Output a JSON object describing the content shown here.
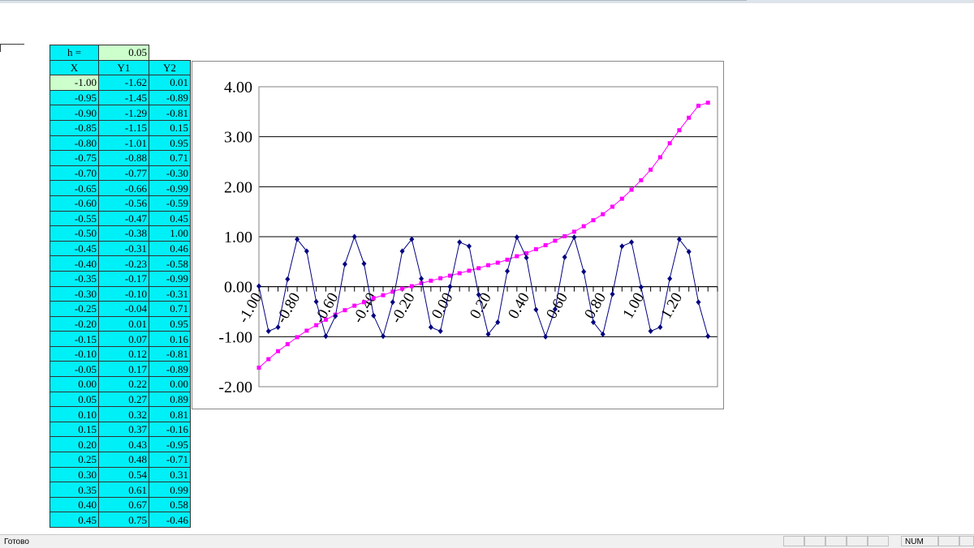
{
  "sheet": {
    "step_label": "h =",
    "step_value": "0.05",
    "headers": [
      "X",
      "Y1",
      "Y2"
    ],
    "rows": [
      [
        "-1.00",
        "-1.62",
        "0.01"
      ],
      [
        "-0.95",
        "-1.45",
        "-0.89"
      ],
      [
        "-0.90",
        "-1.29",
        "-0.81"
      ],
      [
        "-0.85",
        "-1.15",
        "0.15"
      ],
      [
        "-0.80",
        "-1.01",
        "0.95"
      ],
      [
        "-0.75",
        "-0.88",
        "0.71"
      ],
      [
        "-0.70",
        "-0.77",
        "-0.30"
      ],
      [
        "-0.65",
        "-0.66",
        "-0.99"
      ],
      [
        "-0.60",
        "-0.56",
        "-0.59"
      ],
      [
        "-0.55",
        "-0.47",
        "0.45"
      ],
      [
        "-0.50",
        "-0.38",
        "1.00"
      ],
      [
        "-0.45",
        "-0.31",
        "0.46"
      ],
      [
        "-0.40",
        "-0.23",
        "-0.58"
      ],
      [
        "-0.35",
        "-0.17",
        "-0.99"
      ],
      [
        "-0.30",
        "-0.10",
        "-0.31"
      ],
      [
        "-0.25",
        "-0.04",
        "0.71"
      ],
      [
        "-0.20",
        "0.01",
        "0.95"
      ],
      [
        "-0.15",
        "0.07",
        "0.16"
      ],
      [
        "-0.10",
        "0.12",
        "-0.81"
      ],
      [
        "-0.05",
        "0.17",
        "-0.89"
      ],
      [
        "0.00",
        "0.22",
        "0.00"
      ],
      [
        "0.05",
        "0.27",
        "0.89"
      ],
      [
        "0.10",
        "0.32",
        "0.81"
      ],
      [
        "0.15",
        "0.37",
        "-0.16"
      ],
      [
        "0.20",
        "0.43",
        "-0.95"
      ],
      [
        "0.25",
        "0.48",
        "-0.71"
      ],
      [
        "0.30",
        "0.54",
        "0.31"
      ],
      [
        "0.35",
        "0.61",
        "0.99"
      ],
      [
        "0.40",
        "0.67",
        "0.58"
      ],
      [
        "0.45",
        "0.75",
        "-0.46"
      ]
    ]
  },
  "chart_data": {
    "type": "line",
    "y_ticks": [
      "4.00",
      "3.00",
      "2.00",
      "1.00",
      "0.00",
      "-1.00",
      "-2.00"
    ],
    "ylim": [
      -2,
      4
    ],
    "x_ticks": [
      "-1.00",
      "-0.80",
      "-0.60",
      "-0.40",
      "-0.20",
      "0.00",
      "0.20",
      "0.40",
      "0.60",
      "0.80",
      "1.00",
      "1.20"
    ],
    "xlim": [
      -1.0,
      1.4
    ],
    "grid": true,
    "series": [
      {
        "color": "#ff00ff",
        "marker": "square",
        "x": [
          -1.0,
          -0.95,
          -0.9,
          -0.85,
          -0.8,
          -0.75,
          -0.7,
          -0.65,
          -0.6,
          -0.55,
          -0.5,
          -0.45,
          -0.4,
          -0.35,
          -0.3,
          -0.25,
          -0.2,
          -0.15,
          -0.1,
          -0.05,
          0.0,
          0.05,
          0.1,
          0.15,
          0.2,
          0.25,
          0.3,
          0.35,
          0.4,
          0.45,
          0.5,
          0.55,
          0.6,
          0.65,
          0.7,
          0.75,
          0.8,
          0.85,
          0.9,
          0.95,
          1.0,
          1.05,
          1.1,
          1.15,
          1.2,
          1.25,
          1.3,
          1.35
        ],
        "y": [
          -1.62,
          -1.45,
          -1.29,
          -1.15,
          -1.01,
          -0.88,
          -0.77,
          -0.66,
          -0.56,
          -0.47,
          -0.38,
          -0.31,
          -0.23,
          -0.17,
          -0.1,
          -0.04,
          0.01,
          0.07,
          0.12,
          0.17,
          0.22,
          0.27,
          0.32,
          0.37,
          0.43,
          0.48,
          0.54,
          0.61,
          0.67,
          0.75,
          0.83,
          0.92,
          1.01,
          1.1,
          1.21,
          1.33,
          1.45,
          1.6,
          1.76,
          1.94,
          2.13,
          2.34,
          2.59,
          2.87,
          3.13,
          3.38,
          3.62,
          3.68
        ]
      },
      {
        "color": "#000080",
        "marker": "diamond",
        "x": [
          -1.0,
          -0.95,
          -0.9,
          -0.85,
          -0.8,
          -0.75,
          -0.7,
          -0.65,
          -0.6,
          -0.55,
          -0.5,
          -0.45,
          -0.4,
          -0.35,
          -0.3,
          -0.25,
          -0.2,
          -0.15,
          -0.1,
          -0.05,
          0.0,
          0.05,
          0.1,
          0.15,
          0.2,
          0.25,
          0.3,
          0.35,
          0.4,
          0.45,
          0.5,
          0.55,
          0.6,
          0.65,
          0.7,
          0.75,
          0.8,
          0.85,
          0.9,
          0.95,
          1.0,
          1.05,
          1.1,
          1.15,
          1.2,
          1.25,
          1.3,
          1.35
        ],
        "y": [
          0.01,
          -0.89,
          -0.81,
          0.15,
          0.95,
          0.71,
          -0.3,
          -0.99,
          -0.59,
          0.45,
          1.0,
          0.46,
          -0.58,
          -0.99,
          -0.31,
          0.71,
          0.95,
          0.16,
          -0.81,
          -0.89,
          0.0,
          0.89,
          0.81,
          -0.16,
          -0.95,
          -0.71,
          0.31,
          0.99,
          0.58,
          -0.46,
          -1.0,
          -0.45,
          0.59,
          0.99,
          0.3,
          -0.71,
          -0.95,
          -0.15,
          0.81,
          0.89,
          -0.01,
          -0.89,
          -0.81,
          0.16,
          0.95,
          0.7,
          -0.31,
          -0.99
        ]
      }
    ]
  },
  "statusbar": {
    "ready_text": "Готово",
    "num_indicator": "NUM"
  }
}
